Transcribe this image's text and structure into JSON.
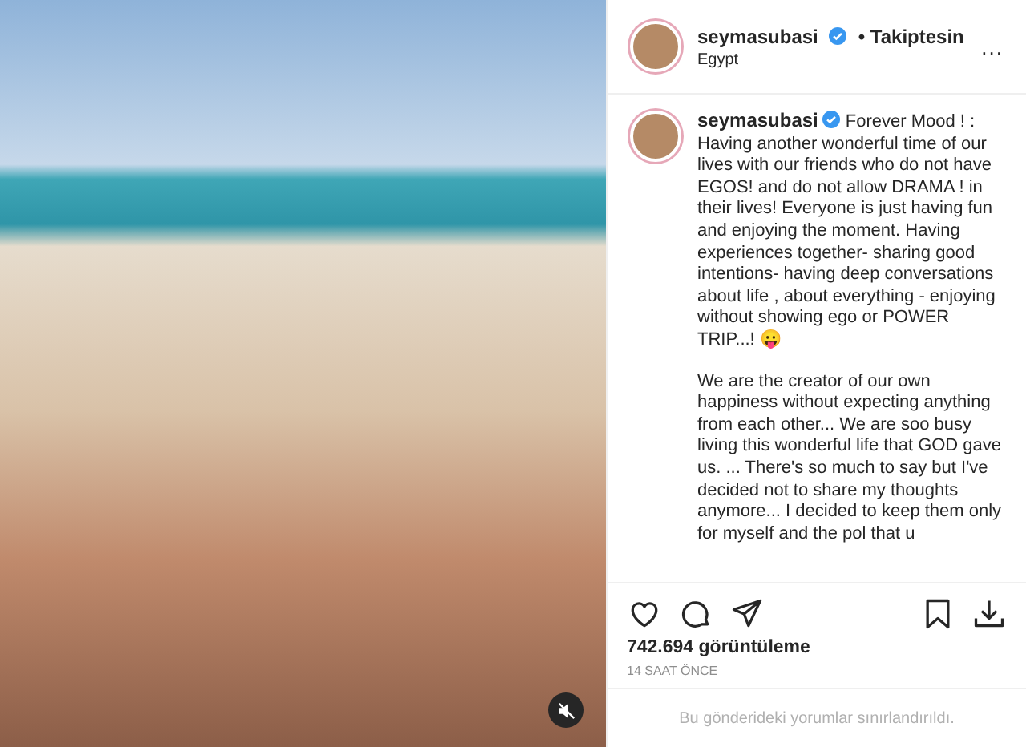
{
  "post": {
    "username": "seymasubasi",
    "follow": "• Takiptesin",
    "location": "Egypt",
    "more": "...",
    "caption": {
      "username": "seymasubasi",
      "paragraphs": [
        "Forever Mood ! : Having another wonderful time of our lives with our friends who do not have EGOS! and do not allow DRAMA ! in their lives! Everyone is just having fun and enjoying the moment. Having experiences together- sharing good intentions- having deep conversations about life , about everything - enjoying without showing ego or POWER TRIP...! 😛",
        "We are the creator of our own happiness without expecting anything from each other... We are soo busy living this wonderful life that GOD gave us. ... There's so much to say but I've decided not to share my thoughts anymore... I decided to keep them only for myself and the pol that u"
      ]
    },
    "views": "742.694 görüntüleme",
    "time": "14 SAAT ÖNCE",
    "comments_notice": "Bu gönderideki yorumlar sınırlandırıldı."
  }
}
